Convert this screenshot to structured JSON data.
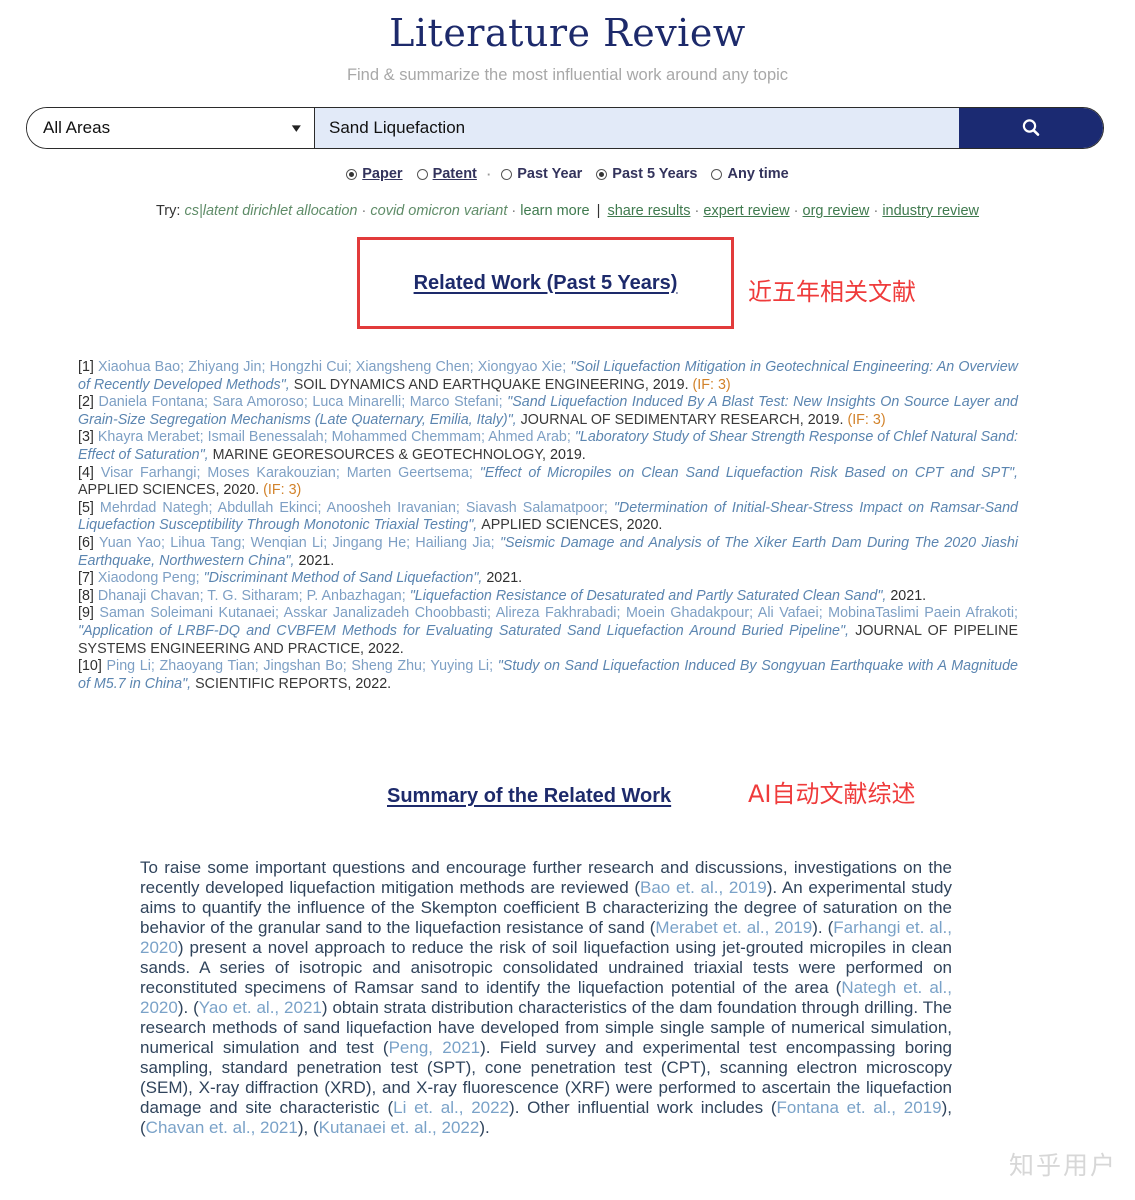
{
  "header": {
    "title": "Literature Review",
    "subtitle": "Find & summarize the most influential work around any topic"
  },
  "search": {
    "area_value": "All Areas",
    "query_value": "Sand Liquefaction",
    "chevron": "chevron-down-icon",
    "button_icon": "search-icon"
  },
  "filters": {
    "type": [
      {
        "label": "Paper",
        "selected": true
      },
      {
        "label": "Patent",
        "selected": false
      }
    ],
    "separator": "·",
    "time": [
      {
        "label": "Past Year",
        "selected": false
      },
      {
        "label": "Past 5 Years",
        "selected": true
      },
      {
        "label": "Any time",
        "selected": false
      }
    ]
  },
  "try_row": {
    "lead": "Try:",
    "examples": [
      "cs|latent dirichlet allocation",
      "covid omicron variant"
    ],
    "learn_more": "learn more",
    "pipe": "|",
    "links": [
      "share results",
      "expert review",
      "org review",
      "industry review"
    ],
    "sep": "·"
  },
  "sections": {
    "related_work_heading": "Related Work (Past 5 Years)",
    "related_work_note_cn": "近五年相关文献",
    "summary_heading": "Summary of the Related Work",
    "summary_note_cn": "AI自动文献综述"
  },
  "references": [
    {
      "index": "[1]",
      "authors": "Xiaohua Bao; Zhiyang Jin; Hongzhi Cui; Xiangsheng Chen; Xiongyao Xie;",
      "title": "\"Soil Liquefaction Mitigation in Geotechnical Engineering: An Overview of Recently Developed Methods\",",
      "journal": "SOIL DYNAMICS AND EARTHQUAKE ENGINEERING,",
      "year": "2019.",
      "impact": "(IF: 3)"
    },
    {
      "index": "[2]",
      "authors": "Daniela Fontana; Sara Amoroso; Luca Minarelli; Marco Stefani;",
      "title": "\"Sand Liquefaction Induced By A Blast Test: New Insights On Source Layer and Grain-Size Segregation Mechanisms (Late Quaternary, Emilia, Italy)\",",
      "journal": "JOURNAL OF SEDIMENTARY RESEARCH,",
      "year": "2019.",
      "impact": "(IF: 3)"
    },
    {
      "index": "[3]",
      "authors": "Khayra Merabet; Ismail Benessalah; Mohammed Chemmam; Ahmed Arab;",
      "title": "\"Laboratory Study of Shear Strength Response of Chlef Natural Sand: Effect of Saturation\",",
      "journal": "MARINE GEORESOURCES & GEOTECHNOLOGY,",
      "year": "2019.",
      "impact": ""
    },
    {
      "index": "[4]",
      "authors": "Visar Farhangi; Moses Karakouzian; Marten Geertsema;",
      "title": "\"Effect of Micropiles on Clean Sand Liquefaction Risk Based on CPT and SPT\",",
      "journal": "APPLIED SCIENCES,",
      "year": "2020.",
      "impact": "(IF: 3)"
    },
    {
      "index": "[5]",
      "authors": "Mehrdad Nategh; Abdullah Ekinci; Anoosheh Iravanian; Siavash Salamatpoor;",
      "title": "\"Determination of Initial-Shear-Stress Impact on Ramsar-Sand Liquefaction Susceptibility Through Monotonic Triaxial Testing\",",
      "journal": "APPLIED SCIENCES,",
      "year": "2020.",
      "impact": ""
    },
    {
      "index": "[6]",
      "authors": "Yuan Yao; Lihua Tang; Wenqian Li; Jingang He; Hailiang Jia;",
      "title": "\"Seismic Damage and Analysis of The Xiker Earth Dam During The 2020 Jiashi Earthquake, Northwestern China\",",
      "journal": "",
      "year": "2021.",
      "impact": ""
    },
    {
      "index": "[7]",
      "authors": "Xiaodong Peng;",
      "title": "\"Discriminant Method of Sand Liquefaction\",",
      "journal": "",
      "year": "2021.",
      "impact": ""
    },
    {
      "index": "[8]",
      "authors": "Dhanaji Chavan; T. G. Sitharam; P. Anbazhagan;",
      "title": "\"Liquefaction Resistance of Desaturated and Partly Saturated Clean Sand\",",
      "journal": "",
      "year": "2021.",
      "impact": ""
    },
    {
      "index": "[9]",
      "authors": "Saman Soleimani Kutanaei; Asskar Janalizadeh Choobbasti; Alireza Fakhrabadi; Moein Ghadakpour; Ali Vafaei; MobinaTaslimi Paein Afrakoti;",
      "title": "\"Application of LRBF-DQ and CVBFEM Methods for Evaluating Saturated Sand Liquefaction Around Buried Pipeline\",",
      "journal": "JOURNAL OF PIPELINE SYSTEMS ENGINEERING AND PRACTICE,",
      "year": "2022.",
      "impact": ""
    },
    {
      "index": "[10]",
      "authors": "Ping Li; Zhaoyang Tian; Jingshan Bo; Sheng Zhu; Yuying Li;",
      "title": "\"Study on Sand Liquefaction Induced By Songyuan Earthquake with A Magnitude of M5.7 in China\",",
      "journal": "SCIENTIFIC REPORTS,",
      "year": "2022.",
      "impact": ""
    }
  ],
  "summary_segments": [
    {
      "t": "To raise some important questions and encourage further research and discussions, investigations on the recently developed liquefaction mitigation methods are reviewed (",
      "c": false
    },
    {
      "t": "Bao et. al., 2019",
      "c": true
    },
    {
      "t": "). An experimental study aims to quantify the influence of the Skempton coefficient B characterizing the degree of saturation on the behavior of the granular sand to the liquefaction resistance of sand (",
      "c": false
    },
    {
      "t": "Merabet et. al., 2019",
      "c": true
    },
    {
      "t": "). (",
      "c": false
    },
    {
      "t": "Farhangi et. al., 2020",
      "c": true
    },
    {
      "t": ") present a novel approach to reduce the risk of soil liquefaction using jet-grouted micropiles in clean sands. A series of isotropic and anisotropic consolidated undrained triaxial tests were performed on reconstituted specimens of Ramsar sand to identify the liquefaction potential of the area (",
      "c": false
    },
    {
      "t": "Nategh et. al., 2020",
      "c": true
    },
    {
      "t": "). (",
      "c": false
    },
    {
      "t": "Yao et. al., 2021",
      "c": true
    },
    {
      "t": ") obtain strata distribution characteristics of the dam foundation through drilling. The research methods of sand liquefaction have developed from simple single sample of numerical simulation, numerical simulation and test (",
      "c": false
    },
    {
      "t": "Peng, 2021",
      "c": true
    },
    {
      "t": "). Field survey and experimental test encompassing boring sampling, standard penetration test (SPT), cone penetration test (CPT), scanning electron microscopy (SEM), X-ray diffraction (XRD), and X-ray fluorescence (XRF) were performed to ascertain the liquefaction damage and site characteristic (",
      "c": false
    },
    {
      "t": "Li et. al., 2022",
      "c": true
    },
    {
      "t": "). Other influential work includes (",
      "c": false
    },
    {
      "t": "Fontana et. al., 2019",
      "c": true
    },
    {
      "t": "), (",
      "c": false
    },
    {
      "t": "Chavan et. al., 2021",
      "c": true
    },
    {
      "t": "), (",
      "c": false
    },
    {
      "t": "Kutanaei et. al., 2022",
      "c": true
    },
    {
      "t": ").",
      "c": false
    }
  ],
  "watermark": "知乎用户",
  "colors": {
    "brand_navy": "#1d2a6b",
    "search_button": "#1b2a72",
    "query_bg": "#e2eaf8",
    "annotation_red": "#ef3b3b",
    "box_red": "#e23b3b",
    "author_blue": "#7d9fc4",
    "title_blue": "#5b85b0",
    "impact_orange": "#d2822a",
    "summary_text": "#30445c",
    "citation_blue": "#7aa2c8",
    "try_green": "#3f7a4e"
  }
}
